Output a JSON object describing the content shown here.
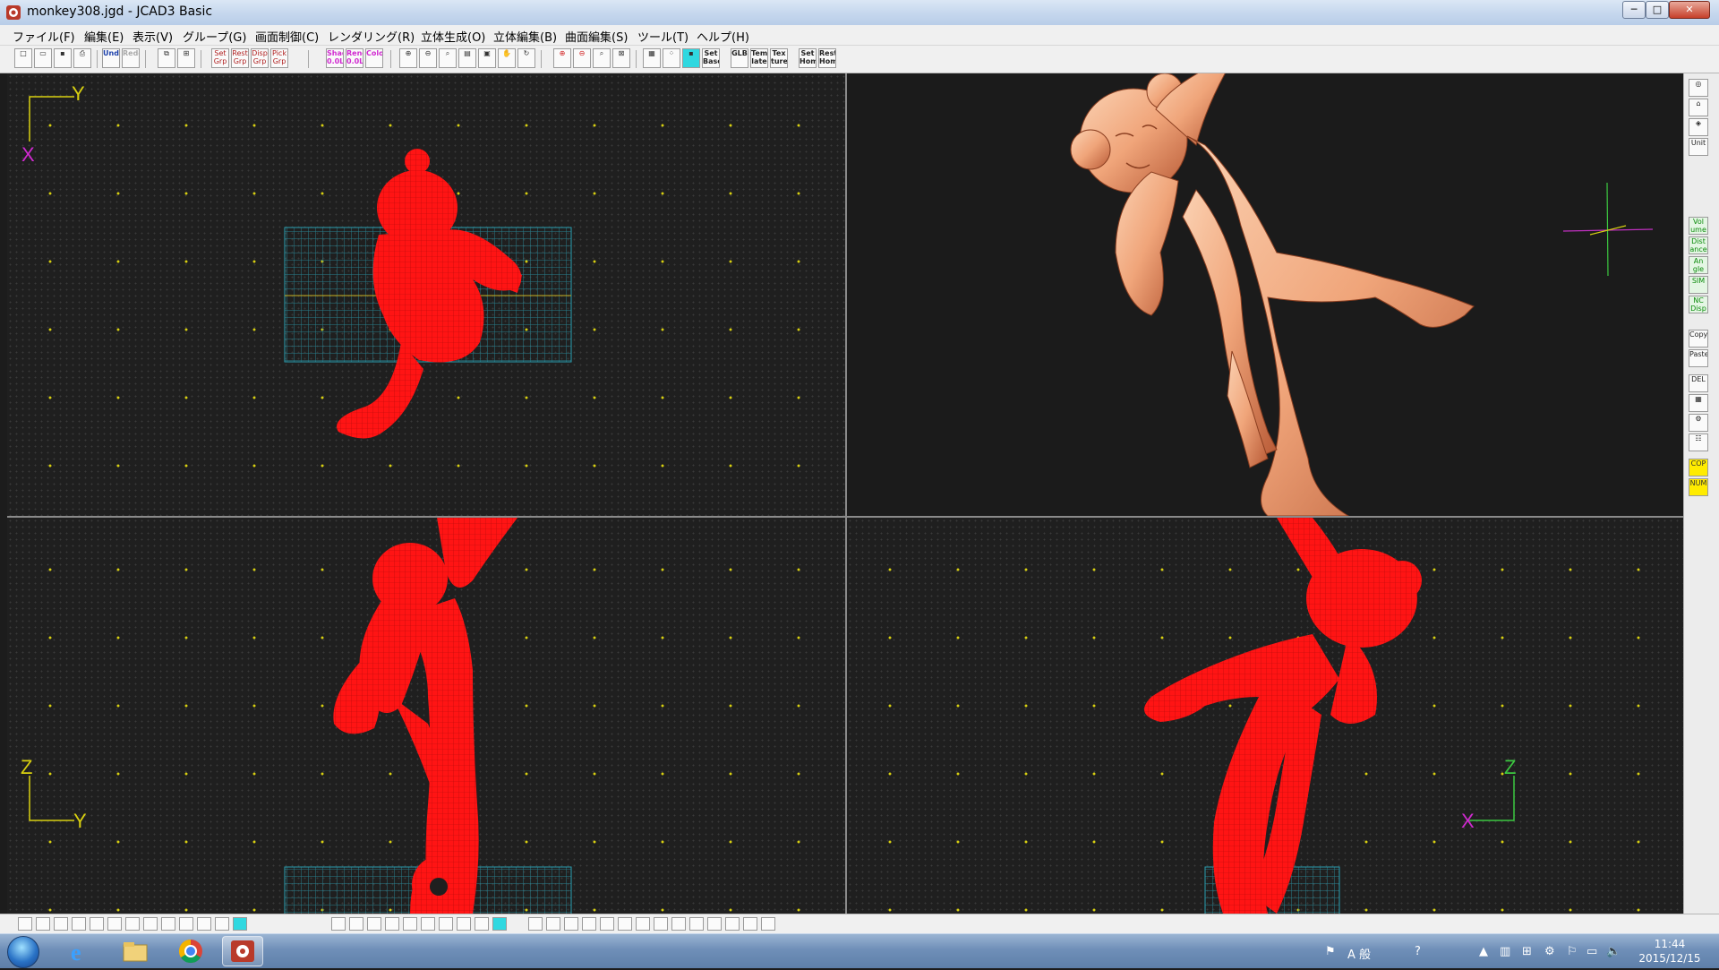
{
  "window": {
    "title": "monkey308.jgd - JCAD3 Basic",
    "controls": [
      "─",
      "□",
      "✕"
    ]
  },
  "menu": [
    "ファイル(F)",
    "編集(E)",
    "表示(V)",
    "グループ(G)",
    "画面制御(C)",
    "レンダリング(R)",
    "立体生成(O)",
    "立体編集(B)",
    "曲面編集(S)",
    "ツール(T)",
    "ヘルプ(H)"
  ],
  "toolbar": {
    "text_buttons": [
      "Undo",
      "Redo",
      "Set Grp",
      "Rest Grp",
      "Disp Grp",
      "Pick Grp",
      "Shad 0.0L",
      "Rend 0.0L",
      "Color",
      "Set Base",
      "GLB",
      "Temp late",
      "Tex ture",
      "Set Home",
      "Rest Home"
    ]
  },
  "viewports": {
    "top_axes": {
      "h": "Y",
      "v": "X"
    },
    "front_axes": {
      "h": "Y",
      "v": "Z"
    },
    "side_axes": {
      "h": "X",
      "v": "Z"
    }
  },
  "right_panel": {
    "buttons": [
      "Unit",
      "Vol ume",
      "Dist ance",
      "An gle",
      "SIM",
      "NC Disp",
      "Copy",
      "Paste",
      "DEL",
      "COP",
      "NUM"
    ]
  },
  "colors": {
    "wireframe": "#ff1414",
    "render": "#f0a57a",
    "grid_cyan": "#2a7f8c",
    "axis_yellow": "#d8d010",
    "dot_yellow": "#d8d010"
  },
  "taskbar": {
    "time": "11:44",
    "date": "2015/12/15",
    "ime": "A 般"
  }
}
